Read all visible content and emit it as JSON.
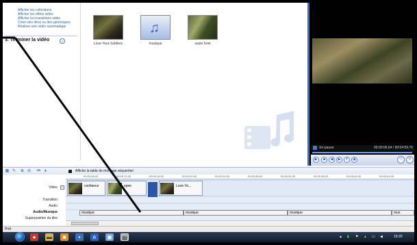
{
  "tasks": {
    "links": [
      "Afficher les collections",
      "Afficher les effets vidéo",
      "Afficher les transitions vidéo",
      "Créer des titres ou des génériques",
      "Réaliser une vidéo automatique"
    ],
    "section_title": "3. Terminer la vidéo"
  },
  "collection": {
    "clips": [
      {
        "label": "Love-Your-Soldiers",
        "icon": "video-thumbnail"
      },
      {
        "label": "musique",
        "icon": "music-note-icon"
      },
      {
        "label": "seule foret",
        "icon": "video-thumbnail"
      }
    ]
  },
  "preview": {
    "status": "En pause",
    "time": "00:00:06,64 / 00:04:59,76"
  },
  "storyboard": {
    "toggle_label": "Affiche la table de montage séquentiel"
  },
  "timeline": {
    "ruler": [
      "00:00:08,00",
      "00:00:12,00",
      "00:00:16,00",
      "00:00:20,00",
      "00:00:24,00",
      "00:00:28,00",
      "00:00:32,00",
      "00:00:36,00",
      "00:00:40,00",
      "00:00:44,00"
    ],
    "track_labels": {
      "video": "Vidéo",
      "transition": "Transition",
      "audio": "Audio",
      "audio_music": "Audio/Musique",
      "title_overlay": "Superposition du titre"
    },
    "video_clips": [
      "confiance",
      "epier",
      "Love-Yo..."
    ],
    "music_clips": [
      "musique",
      "musique",
      "musique",
      "mus"
    ]
  },
  "status": {
    "text": "Prêt"
  },
  "taskbar": {
    "time": "19:20"
  }
}
